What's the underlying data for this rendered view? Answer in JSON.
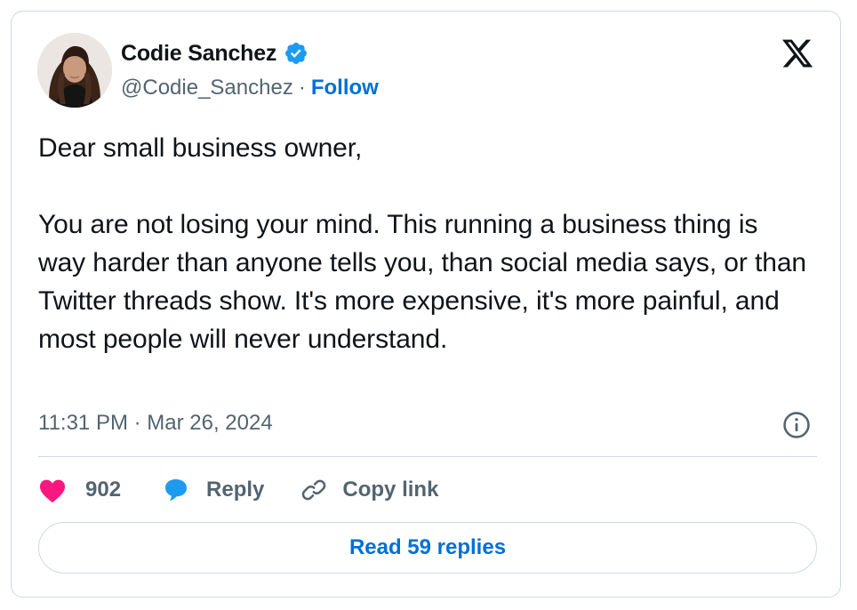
{
  "author": {
    "name": "Codie Sanchez",
    "handle": "@Codie_Sanchez",
    "separator": "·",
    "follow_label": "Follow",
    "verified": true,
    "avatar_icon": "profile-photo"
  },
  "tweet": {
    "text": "Dear small business owner,\n\nYou are not losing your mind. This running a business thing is way harder than anyone tells you, than social media says, or than Twitter threads show. It's more expensive, it's more painful, and most people will never understand.",
    "timestamp": "11:31 PM · Mar 26, 2024"
  },
  "actions": {
    "like_count": "902",
    "reply_label": "Reply",
    "copy_link_label": "Copy link"
  },
  "read_replies_label": "Read 59 replies",
  "icons": {
    "brand": "x-logo-icon",
    "verified": "verified-badge-icon",
    "info": "info-icon",
    "like": "heart-icon",
    "reply": "speech-bubble-icon",
    "copy": "link-icon"
  },
  "colors": {
    "text": "#0f1419",
    "secondary": "#536471",
    "link": "#006fd6",
    "verified": "#1d9bf0",
    "like": "#f91880",
    "reply": "#1d9bf0",
    "border": "#cfd9de"
  }
}
